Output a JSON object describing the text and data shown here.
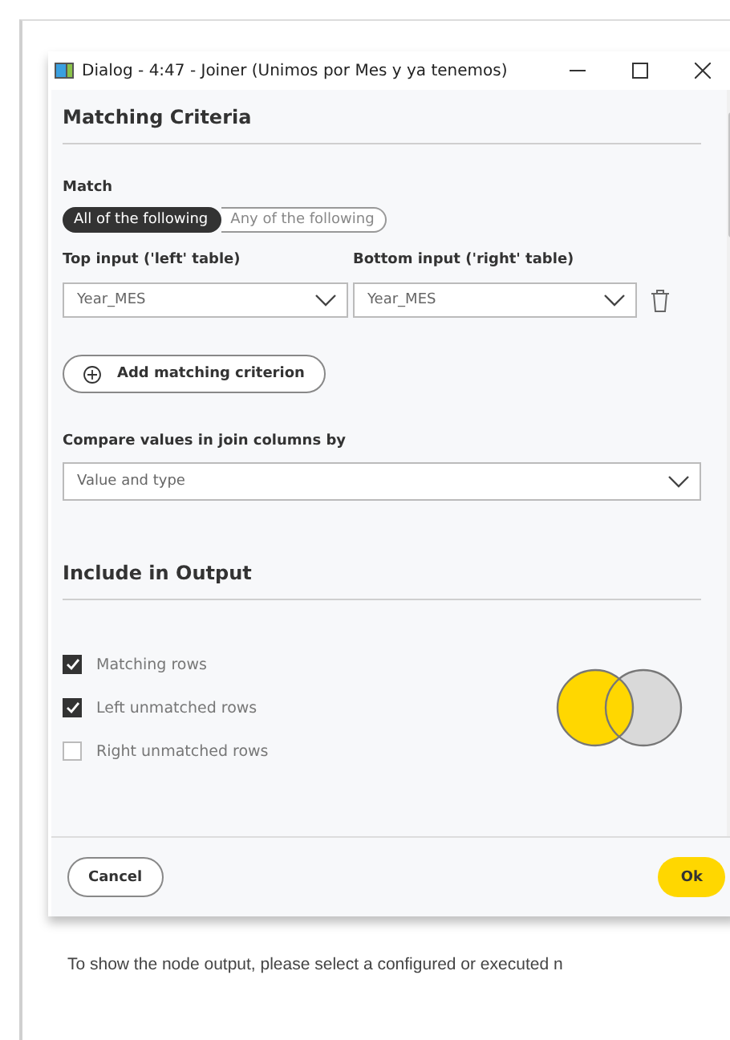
{
  "window": {
    "title": "Dialog - 4:47 - Joiner (Unimos por Mes y ya tenemos)"
  },
  "matching": {
    "heading": "Matching Criteria",
    "match_label": "Match",
    "match_options": [
      {
        "label": "All of the following",
        "selected": true
      },
      {
        "label": "Any of the following",
        "selected": false
      }
    ],
    "left_label": "Top input ('left' table)",
    "right_label": "Bottom input ('right' table)",
    "left_value": "Year_MES",
    "right_value": "Year_MES",
    "add_button": "Add matching criterion",
    "compare_label": "Compare values in join columns by",
    "compare_value": "Value and type"
  },
  "output": {
    "heading": "Include in Output",
    "options": [
      {
        "label": "Matching rows",
        "checked": true
      },
      {
        "label": "Left unmatched rows",
        "checked": true
      },
      {
        "label": "Right unmatched rows",
        "checked": false
      }
    ]
  },
  "buttons": {
    "cancel": "Cancel",
    "ok": "Ok"
  },
  "footer_text": "To show the node output, please select a configured or executed n"
}
